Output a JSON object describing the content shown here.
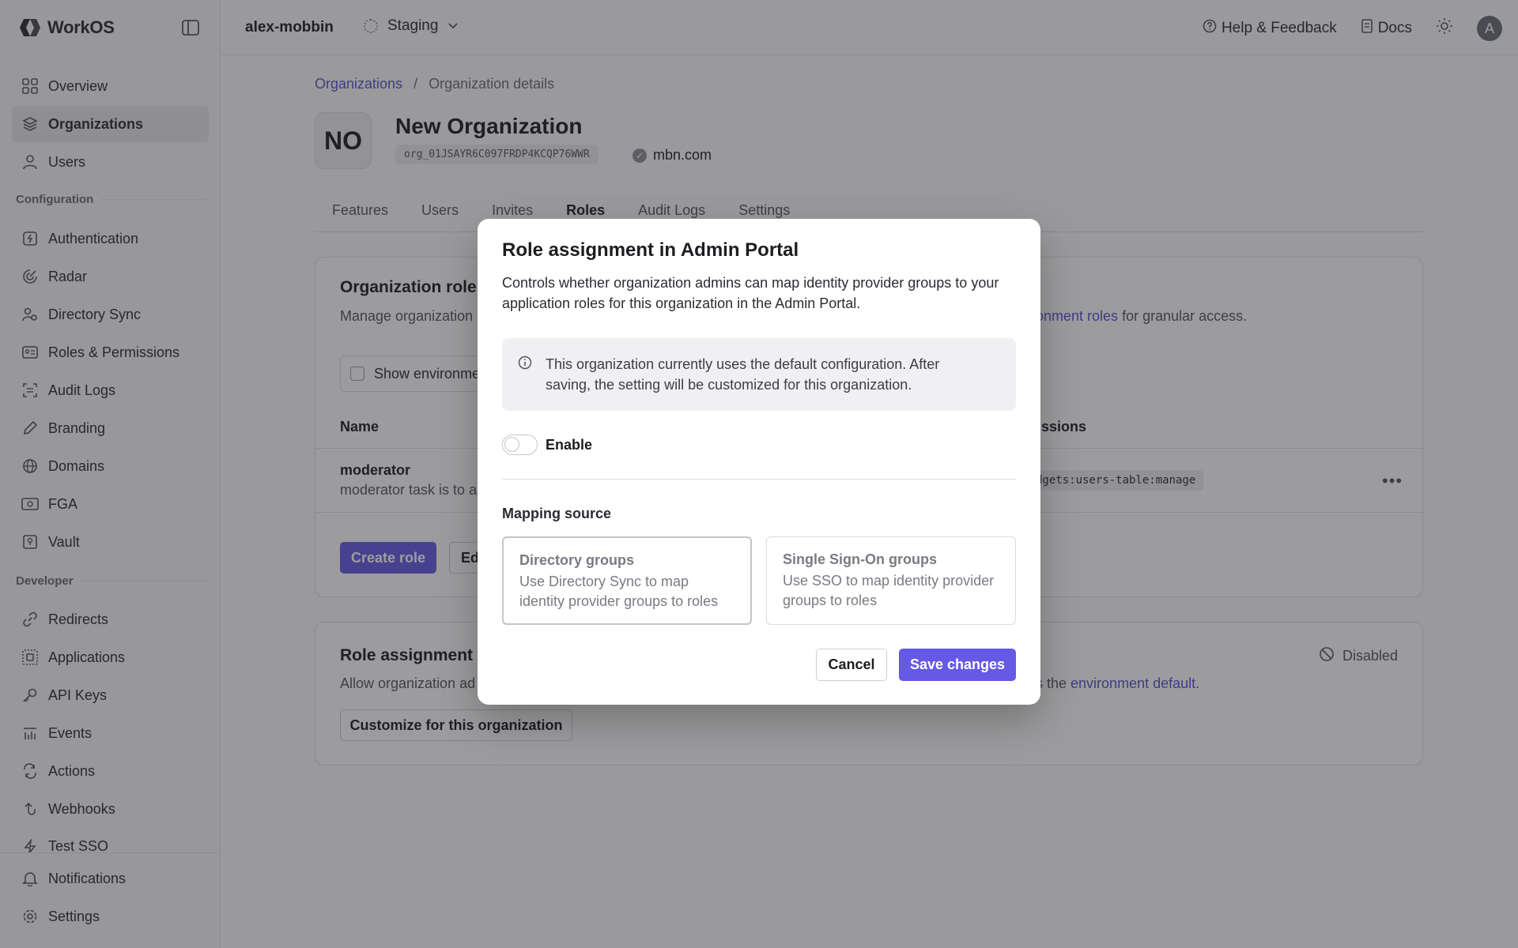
{
  "app": {
    "logo_text": "WorkOS",
    "team": "alex-mobbin",
    "environment": "Staging",
    "help_label": "Help & Feedback",
    "docs_label": "Docs",
    "avatar_initial": "A"
  },
  "sidebar": {
    "items_top": [
      {
        "label": "Overview",
        "icon": "grid-icon"
      },
      {
        "label": "Organizations",
        "icon": "layers-icon",
        "active": true
      },
      {
        "label": "Users",
        "icon": "user-icon"
      }
    ],
    "section_config": "Configuration",
    "items_config": [
      {
        "label": "Authentication",
        "icon": "auth-icon"
      },
      {
        "label": "Radar",
        "icon": "radar-icon"
      },
      {
        "label": "Directory Sync",
        "icon": "directory-sync-icon"
      },
      {
        "label": "Roles & Permissions",
        "icon": "roles-icon"
      },
      {
        "label": "Audit Logs",
        "icon": "audit-logs-icon"
      },
      {
        "label": "Branding",
        "icon": "branding-icon"
      },
      {
        "label": "Domains",
        "icon": "globe-icon"
      },
      {
        "label": "FGA",
        "icon": "fga-icon"
      },
      {
        "label": "Vault",
        "icon": "vault-icon"
      }
    ],
    "section_dev": "Developer",
    "items_dev": [
      {
        "label": "Redirects",
        "icon": "link-icon"
      },
      {
        "label": "Applications",
        "icon": "applications-icon"
      },
      {
        "label": "API Keys",
        "icon": "key-icon"
      },
      {
        "label": "Events",
        "icon": "events-icon"
      },
      {
        "label": "Actions",
        "icon": "actions-icon"
      },
      {
        "label": "Webhooks",
        "icon": "webhooks-icon"
      },
      {
        "label": "Test SSO",
        "icon": "bolt-icon"
      }
    ],
    "items_bottom": [
      {
        "label": "Notifications",
        "icon": "bell-icon"
      },
      {
        "label": "Settings",
        "icon": "gear-icon"
      }
    ]
  },
  "breadcrumb": {
    "parent": "Organizations",
    "separator": "/",
    "current": "Organization details"
  },
  "org": {
    "initials": "NO",
    "name": "New Organization",
    "id": "org_01JSAYR6C097FRDP4KCQP76WWR",
    "domain": "mbn.com"
  },
  "tabs": [
    "Features",
    "Users",
    "Invites",
    "Roles",
    "Audit Logs",
    "Settings"
  ],
  "roles_card": {
    "title": "Organization roles",
    "desc_prefix": "Manage organization",
    "desc_link": "onment roles",
    "desc_suffix": " for granular access.",
    "checkbox_label": "Show environme",
    "col_name": "Name",
    "col_permissions": "missions",
    "row_name": "moderator",
    "row_desc": "moderator task is to a",
    "row_permission": "dgets:users-table:manage",
    "create_btn": "Create role",
    "edit_btn": "Ed"
  },
  "assign_card": {
    "title": "Role assignment i",
    "desc_prefix": "Allow organization ad",
    "desc_mid": "s the ",
    "desc_link": "environment default",
    "desc_end": ".",
    "status": "Disabled",
    "customize_btn": "Customize for this organization"
  },
  "modal": {
    "title": "Role assignment in Admin Portal",
    "description": "Controls whether organization admins can map identity provider groups to your application roles for this organization in the Admin Portal.",
    "info": "This organization currently uses the default configuration. After saving, the setting will be customized for this organization.",
    "toggle_label": "Enable",
    "toggle_on": false,
    "section_label": "Mapping source",
    "options": [
      {
        "title": "Directory groups",
        "desc": "Use Directory Sync to map identity provider groups to roles",
        "selected": true
      },
      {
        "title": "Single Sign-On groups",
        "desc": "Use SSO to map identity provider groups to roles",
        "selected": false
      }
    ],
    "cancel_label": "Cancel",
    "save_label": "Save changes"
  },
  "colors": {
    "accent": "#6559e6",
    "link": "#5b4fd0",
    "overlay": "rgba(35,35,40,0.45)"
  }
}
